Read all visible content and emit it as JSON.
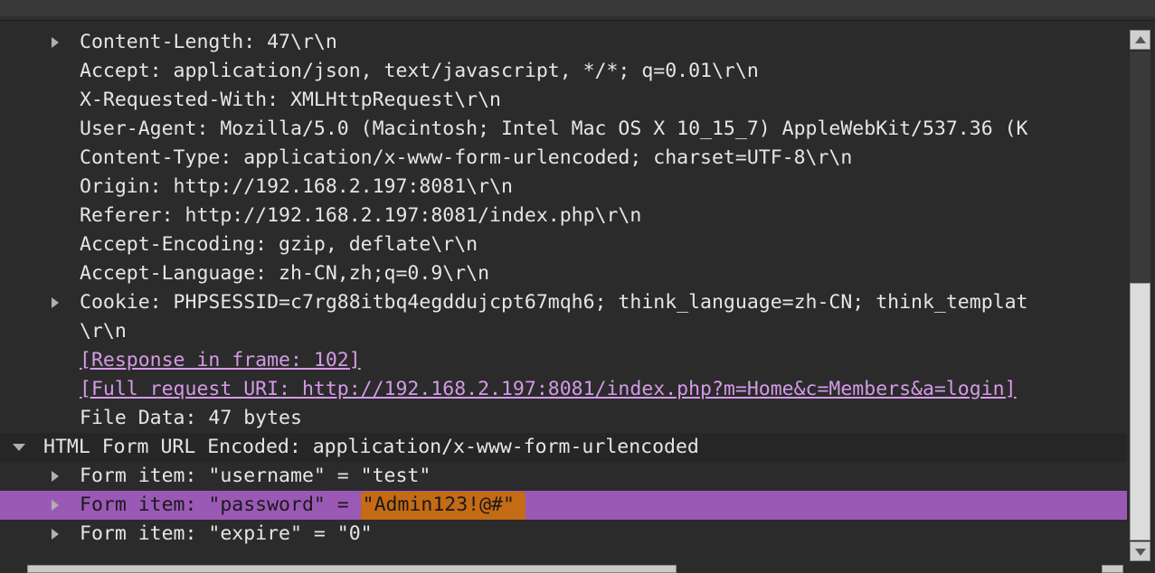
{
  "rows": [
    {
      "text": "Content-Length: 47\\r\\n",
      "expand": true
    },
    {
      "text": "Accept: application/json, text/javascript, */*; q=0.01\\r\\n"
    },
    {
      "text": "X-Requested-With: XMLHttpRequest\\r\\n"
    },
    {
      "text": "User-Agent: Mozilla/5.0 (Macintosh; Intel Mac OS X 10_15_7) AppleWebKit/537.36 (K"
    },
    {
      "text": "Content-Type: application/x-www-form-urlencoded; charset=UTF-8\\r\\n"
    },
    {
      "text": "Origin: http://192.168.2.197:8081\\r\\n"
    },
    {
      "text": "Referer: http://192.168.2.197:8081/index.php\\r\\n"
    },
    {
      "text": "Accept-Encoding: gzip, deflate\\r\\n"
    },
    {
      "text": "Accept-Language: zh-CN,zh;q=0.9\\r\\n"
    },
    {
      "text": "Cookie: PHPSESSID=c7rg88itbq4egddujcpt67mqh6; think_language=zh-CN; think_templat",
      "expand": true
    },
    {
      "text": "\\r\\n"
    },
    {
      "text": "[Response in frame: 102]",
      "link": true
    },
    {
      "text": "[Full request URI: http://192.168.2.197:8081/index.php?m=Home&c=Members&a=login]",
      "link": true
    },
    {
      "text": "File Data: 47 bytes"
    }
  ],
  "section": {
    "text": "HTML Form URL Encoded: application/x-www-form-urlencoded"
  },
  "form_items": [
    {
      "text": "Form item: \"username\" = \"test\""
    },
    {
      "prefix": "Form item: \"password\" = ",
      "value": "\"Admin123!@#\""
    },
    {
      "text": "Form item: \"expire\" = \"0\""
    }
  ],
  "colors": {
    "background": "#2b2b2b",
    "text": "#e6e6e6",
    "link": "#d59ae8",
    "selected_row": "#9b59b6",
    "highlight": "#c56a15"
  }
}
